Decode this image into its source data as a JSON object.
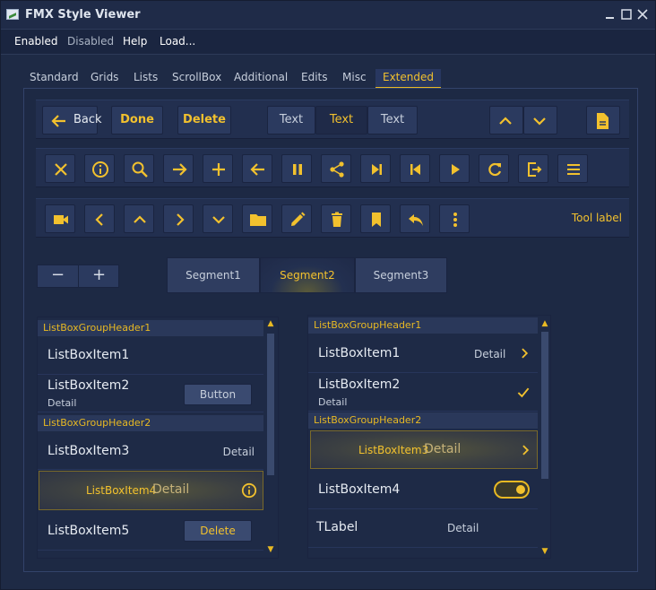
{
  "window": {
    "title": "FMX Style Viewer"
  },
  "menu": {
    "items": [
      "Enabled",
      "Disabled",
      "Help",
      "Load..."
    ]
  },
  "tabs": [
    "Standard",
    "Grids",
    "Lists",
    "ScrollBox",
    "Additional",
    "Edits",
    "Misc",
    "Extended"
  ],
  "toolbar1": {
    "back": "Back",
    "done": "Done",
    "delete": "Delete",
    "seg1": "Text",
    "seg2": "Text",
    "seg3": "Text"
  },
  "toolbar3": {
    "tool_label": "Tool label"
  },
  "stepper": {
    "minus": "−",
    "plus": "+"
  },
  "segments": [
    "Segment1",
    "Segment2",
    "Segment3"
  ],
  "listLeft": {
    "header1": "ListBoxGroupHeader1",
    "item1": "ListBoxItem1",
    "item2": "ListBoxItem2",
    "item2_sub": "Detail",
    "item2_button": "Button",
    "header2": "ListBoxGroupHeader2",
    "item3": "ListBoxItem3",
    "item3_detail": "Detail",
    "item4": "ListBoxItem4",
    "item4_detail": "Detail",
    "item5": "ListBoxItem5",
    "item5_button": "Delete"
  },
  "listRight": {
    "header1": "ListBoxGroupHeader1",
    "item1": "ListBoxItem1",
    "item1_detail": "Detail",
    "item2": "ListBoxItem2",
    "item2_sub": "Detail",
    "header2": "ListBoxGroupHeader2",
    "item3": "ListBoxItem3",
    "item3_detail": "Detail",
    "item4": "ListBoxItem4",
    "tlabel": "TLabel",
    "tlabel_detail": "Detail"
  },
  "colors": {
    "accent": "#f2c12e",
    "background": "#1e2a45",
    "button": "#2b3a5f"
  }
}
